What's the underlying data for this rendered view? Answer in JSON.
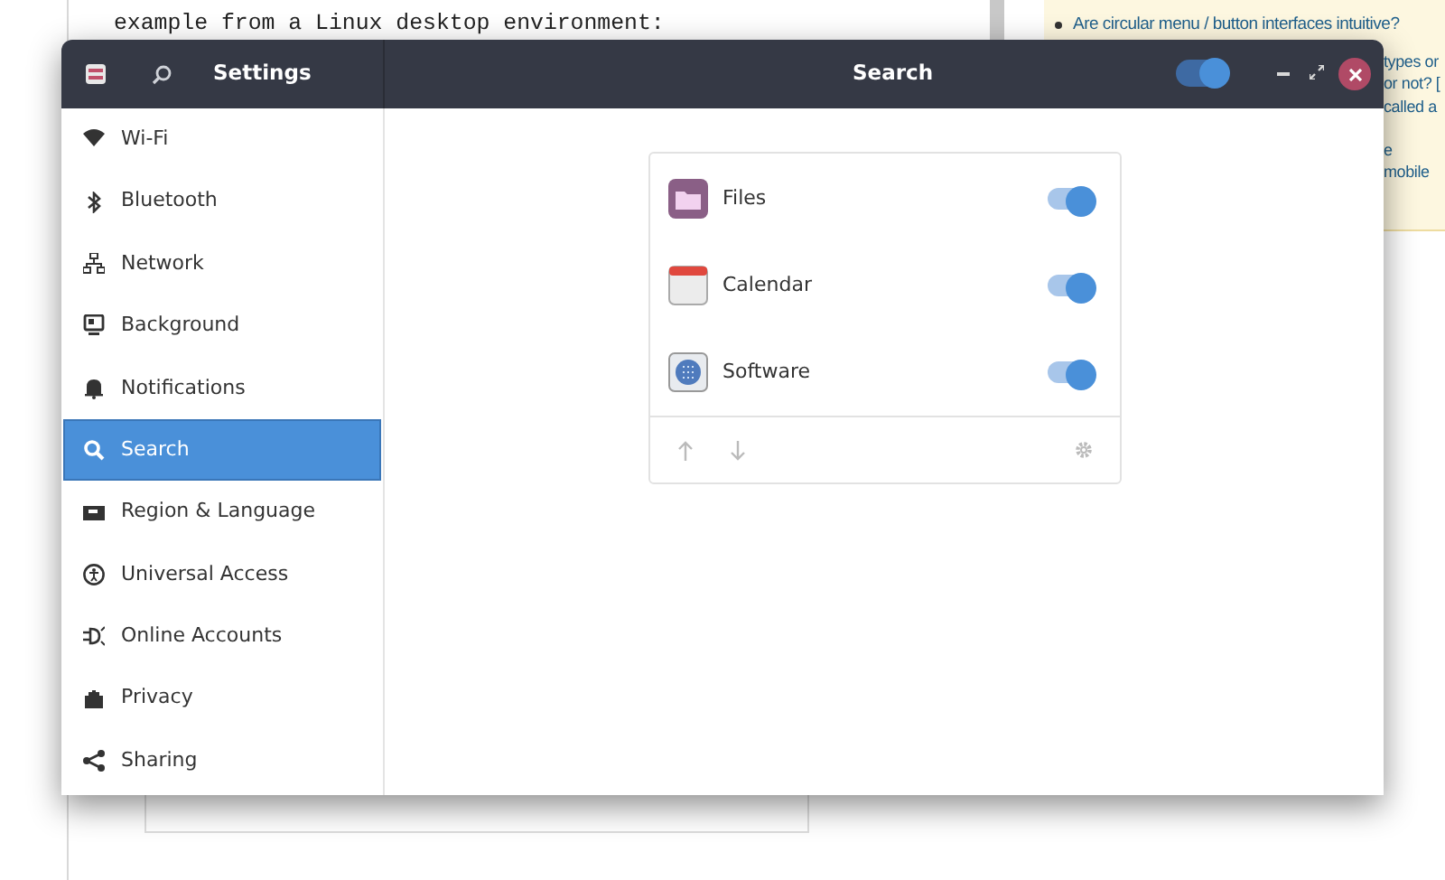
{
  "background_page": {
    "question_text": "example from a Linux desktop environment:",
    "related_links": [
      "Are circular menu / button interfaces intuitive?"
    ],
    "partial_link_texts": [
      "types or",
      "or not? [",
      "called a",
      "e",
      "mobile"
    ]
  },
  "window": {
    "title": "Settings",
    "page_title": "Search",
    "search_switch": {
      "on": true
    }
  },
  "sidebar": {
    "items": [
      {
        "label": "Wi-Fi",
        "selected": false
      },
      {
        "label": "Bluetooth",
        "selected": false
      },
      {
        "label": "Network",
        "selected": false
      },
      {
        "label": "Background",
        "selected": false
      },
      {
        "label": "Notifications",
        "selected": false
      },
      {
        "label": "Search",
        "selected": true
      },
      {
        "label": "Region & Language",
        "selected": false
      },
      {
        "label": "Universal Access",
        "selected": false
      },
      {
        "label": "Online Accounts",
        "selected": false
      },
      {
        "label": "Privacy",
        "selected": false
      },
      {
        "label": "Sharing",
        "selected": false
      }
    ]
  },
  "search_providers": [
    {
      "label": "Files",
      "on": true
    },
    {
      "label": "Calendar",
      "on": true
    },
    {
      "label": "Software",
      "on": true
    }
  ]
}
